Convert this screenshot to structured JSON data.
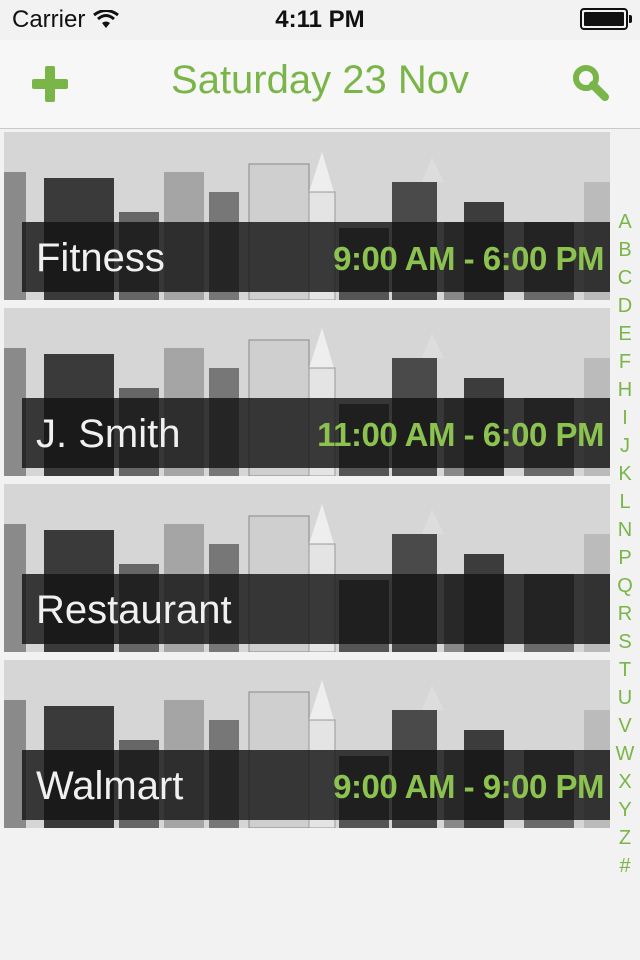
{
  "status_bar": {
    "carrier": "Carrier",
    "time": "4:11 PM"
  },
  "nav": {
    "title": "Saturday 23 Nov",
    "add_icon": "plus-icon",
    "search_icon": "search-icon"
  },
  "colors": {
    "accent": "#79b548",
    "hours": "#8cc24f",
    "band": "#141414",
    "background": "#f2f2f2"
  },
  "items": [
    {
      "name": "Fitness",
      "hours": "9:00 AM - 6:00 PM"
    },
    {
      "name": "J. Smith",
      "hours": "11:00 AM - 6:00 PM"
    },
    {
      "name": "Restaurant",
      "hours": ""
    },
    {
      "name": "Walmart",
      "hours": "9:00 AM - 9:00 PM"
    }
  ],
  "index_letters": [
    "A",
    "B",
    "C",
    "D",
    "E",
    "F",
    "H",
    "I",
    "J",
    "K",
    "L",
    "N",
    "P",
    "Q",
    "R",
    "S",
    "T",
    "U",
    "V",
    "W",
    "X",
    "Y",
    "Z",
    "#"
  ]
}
